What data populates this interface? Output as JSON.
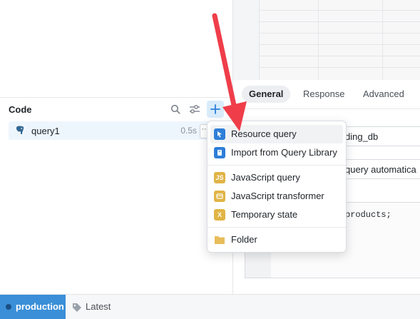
{
  "code_panel": {
    "title": "Code",
    "query": {
      "name": "query1",
      "time": "0.5s"
    }
  },
  "tabs": [
    "General",
    "Response",
    "Advanced"
  ],
  "form": {
    "resource_value": "ding_db",
    "run_setting": "query automatica",
    "sql_snippet": "products;"
  },
  "menu": {
    "items": [
      {
        "label": "Resource query",
        "icon": "resource-icon",
        "color": "#2f7ed8"
      },
      {
        "label": "Import from Query Library",
        "icon": "library-icon",
        "color": "#2f7ed8"
      },
      {
        "label": "JavaScript query",
        "icon": "js-icon",
        "color": "#e0b445",
        "glyph": "JS"
      },
      {
        "label": "JavaScript transformer",
        "icon": "transformer-icon",
        "color": "#e0b445"
      },
      {
        "label": "Temporary state",
        "icon": "state-icon",
        "color": "#e0b445",
        "glyph": "X"
      },
      {
        "label": "Folder",
        "icon": "folder-icon",
        "color": "#e8bd5a"
      }
    ]
  },
  "status_bar": {
    "environment": "production",
    "version": "Latest"
  },
  "colors": {
    "accent": "#3a8fd8",
    "annotation_arrow": "#ef3e4a"
  }
}
